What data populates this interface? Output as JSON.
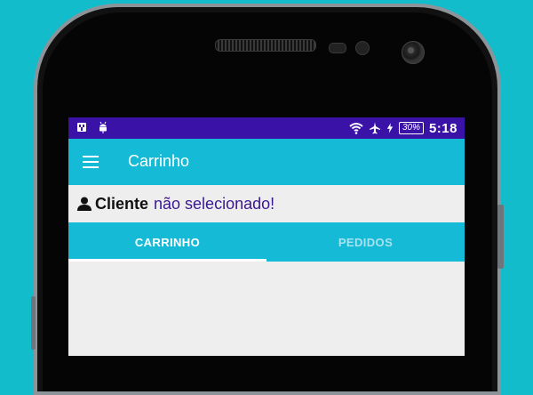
{
  "status_bar": {
    "icons_left": [
      "usb-icon",
      "android-debug-icon"
    ],
    "icons_right": [
      "wifi-icon",
      "airplane-mode-icon",
      "charging-bolt-icon"
    ],
    "battery_percent": "30%",
    "time": "5:18"
  },
  "toolbar": {
    "menu_icon": "hamburger-menu-icon",
    "title": "Carrinho"
  },
  "client": {
    "icon": "person-icon",
    "label": "Cliente",
    "status": "não selecionado!"
  },
  "tabs": [
    {
      "label": "CARRINHO",
      "active": true
    },
    {
      "label": "PEDIDOS",
      "active": false
    }
  ],
  "colors": {
    "status_bar": "#3b12a8",
    "toolbar": "#15bad6",
    "background": "#12bccb",
    "client_status_text": "#3a1890"
  }
}
